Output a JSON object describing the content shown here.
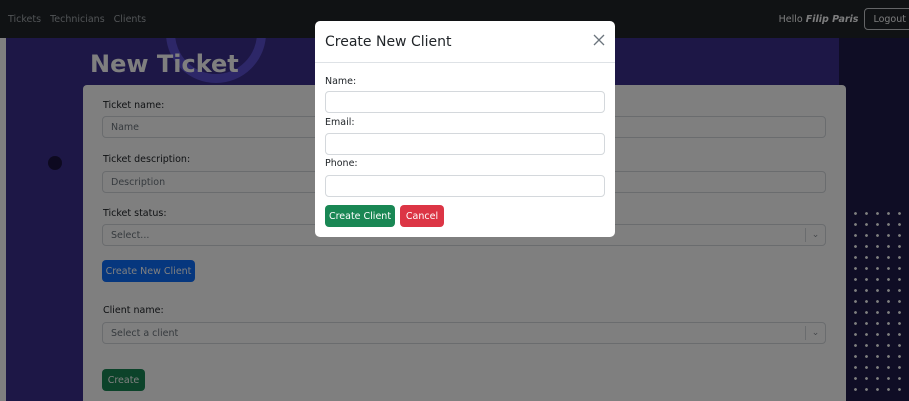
{
  "navbar": {
    "links": [
      "Tickets",
      "Technicians",
      "Clients"
    ],
    "greeting": "Hello",
    "user_name": "Filip Paris",
    "logout_label": "Logout"
  },
  "page": {
    "title": "New Ticket"
  },
  "form": {
    "ticket_name_label": "Ticket name:",
    "ticket_name_placeholder": "Name",
    "ticket_description_label": "Ticket description:",
    "ticket_description_placeholder": "Description",
    "ticket_status_label": "Ticket status:",
    "ticket_status_value": "Select...",
    "create_new_client_label": "Create New Client",
    "client_name_label": "Client name:",
    "client_name_value": "Select a client",
    "create_label": "Create"
  },
  "modal": {
    "title": "Create New Client",
    "name_label": "Name:",
    "email_label": "Email:",
    "phone_label": "Phone:",
    "create_client_label": "Create Client",
    "cancel_label": "Cancel"
  },
  "colors": {
    "navbar": "#212529",
    "hero": "#3b2f8c",
    "primary": "#0d6efd",
    "success": "#198754",
    "danger": "#dc3545"
  }
}
